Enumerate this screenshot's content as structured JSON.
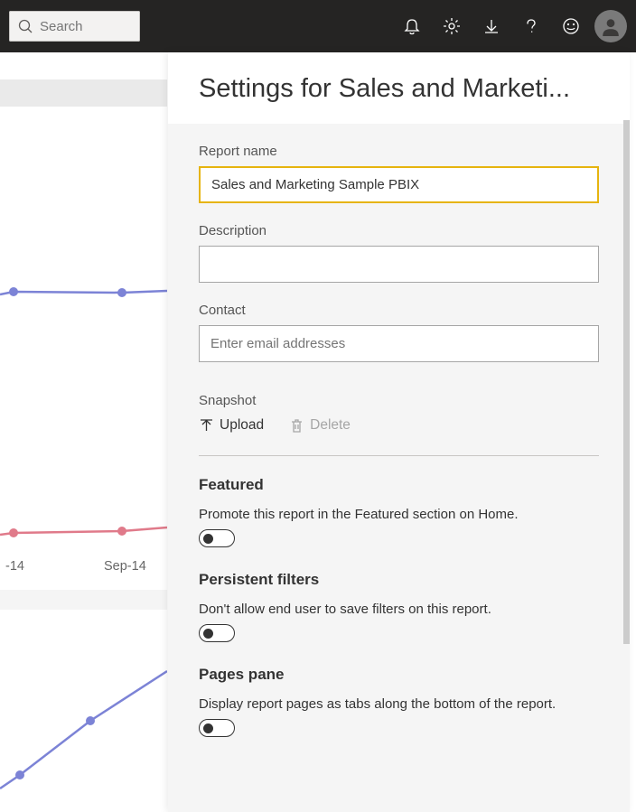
{
  "topbar": {
    "search_placeholder": "Search"
  },
  "bg": {
    "axis_label_1": "-14",
    "axis_label_2": "Sep-14"
  },
  "panel": {
    "title": "Settings for Sales and Marketi...",
    "report_name_label": "Report name",
    "report_name_value": "Sales and Marketing Sample PBIX",
    "description_label": "Description",
    "description_value": "",
    "contact_label": "Contact",
    "contact_placeholder": "Enter email addresses",
    "snapshot_label": "Snapshot",
    "upload_label": "Upload",
    "delete_label": "Delete",
    "featured_title": "Featured",
    "featured_desc": "Promote this report in the Featured section on Home.",
    "filters_title": "Persistent filters",
    "filters_desc": "Don't allow end user to save filters on this report.",
    "pages_title": "Pages pane",
    "pages_desc": "Display report pages as tabs along the bottom of the report."
  }
}
